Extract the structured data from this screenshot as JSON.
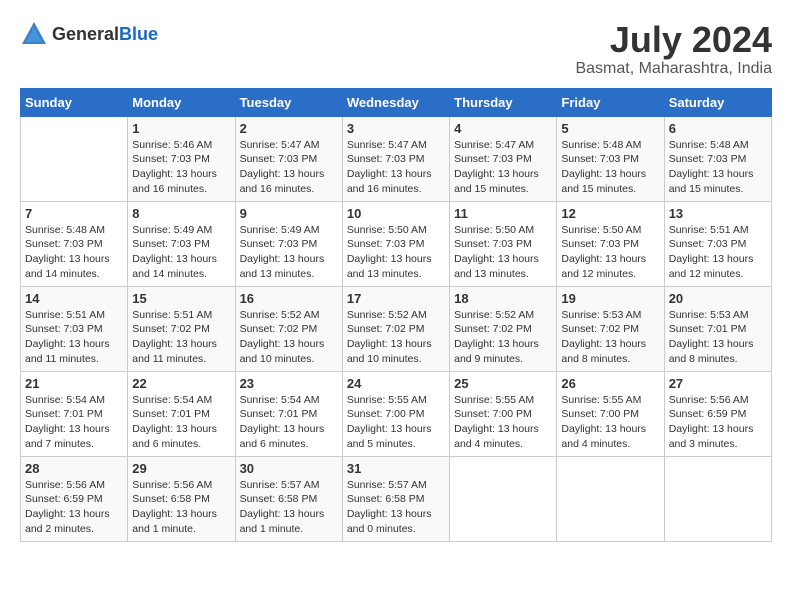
{
  "header": {
    "logo_general": "General",
    "logo_blue": "Blue",
    "month_title": "July 2024",
    "subtitle": "Basmat, Maharashtra, India"
  },
  "calendar": {
    "days_of_week": [
      "Sunday",
      "Monday",
      "Tuesday",
      "Wednesday",
      "Thursday",
      "Friday",
      "Saturday"
    ],
    "weeks": [
      [
        {
          "day": "",
          "content": ""
        },
        {
          "day": "1",
          "content": "Sunrise: 5:46 AM\nSunset: 7:03 PM\nDaylight: 13 hours\nand 16 minutes."
        },
        {
          "day": "2",
          "content": "Sunrise: 5:47 AM\nSunset: 7:03 PM\nDaylight: 13 hours\nand 16 minutes."
        },
        {
          "day": "3",
          "content": "Sunrise: 5:47 AM\nSunset: 7:03 PM\nDaylight: 13 hours\nand 16 minutes."
        },
        {
          "day": "4",
          "content": "Sunrise: 5:47 AM\nSunset: 7:03 PM\nDaylight: 13 hours\nand 15 minutes."
        },
        {
          "day": "5",
          "content": "Sunrise: 5:48 AM\nSunset: 7:03 PM\nDaylight: 13 hours\nand 15 minutes."
        },
        {
          "day": "6",
          "content": "Sunrise: 5:48 AM\nSunset: 7:03 PM\nDaylight: 13 hours\nand 15 minutes."
        }
      ],
      [
        {
          "day": "7",
          "content": "Sunrise: 5:48 AM\nSunset: 7:03 PM\nDaylight: 13 hours\nand 14 minutes."
        },
        {
          "day": "8",
          "content": "Sunrise: 5:49 AM\nSunset: 7:03 PM\nDaylight: 13 hours\nand 14 minutes."
        },
        {
          "day": "9",
          "content": "Sunrise: 5:49 AM\nSunset: 7:03 PM\nDaylight: 13 hours\nand 13 minutes."
        },
        {
          "day": "10",
          "content": "Sunrise: 5:50 AM\nSunset: 7:03 PM\nDaylight: 13 hours\nand 13 minutes."
        },
        {
          "day": "11",
          "content": "Sunrise: 5:50 AM\nSunset: 7:03 PM\nDaylight: 13 hours\nand 13 minutes."
        },
        {
          "day": "12",
          "content": "Sunrise: 5:50 AM\nSunset: 7:03 PM\nDaylight: 13 hours\nand 12 minutes."
        },
        {
          "day": "13",
          "content": "Sunrise: 5:51 AM\nSunset: 7:03 PM\nDaylight: 13 hours\nand 12 minutes."
        }
      ],
      [
        {
          "day": "14",
          "content": "Sunrise: 5:51 AM\nSunset: 7:03 PM\nDaylight: 13 hours\nand 11 minutes."
        },
        {
          "day": "15",
          "content": "Sunrise: 5:51 AM\nSunset: 7:02 PM\nDaylight: 13 hours\nand 11 minutes."
        },
        {
          "day": "16",
          "content": "Sunrise: 5:52 AM\nSunset: 7:02 PM\nDaylight: 13 hours\nand 10 minutes."
        },
        {
          "day": "17",
          "content": "Sunrise: 5:52 AM\nSunset: 7:02 PM\nDaylight: 13 hours\nand 10 minutes."
        },
        {
          "day": "18",
          "content": "Sunrise: 5:52 AM\nSunset: 7:02 PM\nDaylight: 13 hours\nand 9 minutes."
        },
        {
          "day": "19",
          "content": "Sunrise: 5:53 AM\nSunset: 7:02 PM\nDaylight: 13 hours\nand 8 minutes."
        },
        {
          "day": "20",
          "content": "Sunrise: 5:53 AM\nSunset: 7:01 PM\nDaylight: 13 hours\nand 8 minutes."
        }
      ],
      [
        {
          "day": "21",
          "content": "Sunrise: 5:54 AM\nSunset: 7:01 PM\nDaylight: 13 hours\nand 7 minutes."
        },
        {
          "day": "22",
          "content": "Sunrise: 5:54 AM\nSunset: 7:01 PM\nDaylight: 13 hours\nand 6 minutes."
        },
        {
          "day": "23",
          "content": "Sunrise: 5:54 AM\nSunset: 7:01 PM\nDaylight: 13 hours\nand 6 minutes."
        },
        {
          "day": "24",
          "content": "Sunrise: 5:55 AM\nSunset: 7:00 PM\nDaylight: 13 hours\nand 5 minutes."
        },
        {
          "day": "25",
          "content": "Sunrise: 5:55 AM\nSunset: 7:00 PM\nDaylight: 13 hours\nand 4 minutes."
        },
        {
          "day": "26",
          "content": "Sunrise: 5:55 AM\nSunset: 7:00 PM\nDaylight: 13 hours\nand 4 minutes."
        },
        {
          "day": "27",
          "content": "Sunrise: 5:56 AM\nSunset: 6:59 PM\nDaylight: 13 hours\nand 3 minutes."
        }
      ],
      [
        {
          "day": "28",
          "content": "Sunrise: 5:56 AM\nSunset: 6:59 PM\nDaylight: 13 hours\nand 2 minutes."
        },
        {
          "day": "29",
          "content": "Sunrise: 5:56 AM\nSunset: 6:58 PM\nDaylight: 13 hours\nand 1 minute."
        },
        {
          "day": "30",
          "content": "Sunrise: 5:57 AM\nSunset: 6:58 PM\nDaylight: 13 hours\nand 1 minute."
        },
        {
          "day": "31",
          "content": "Sunrise: 5:57 AM\nSunset: 6:58 PM\nDaylight: 13 hours\nand 0 minutes."
        },
        {
          "day": "",
          "content": ""
        },
        {
          "day": "",
          "content": ""
        },
        {
          "day": "",
          "content": ""
        }
      ]
    ]
  }
}
